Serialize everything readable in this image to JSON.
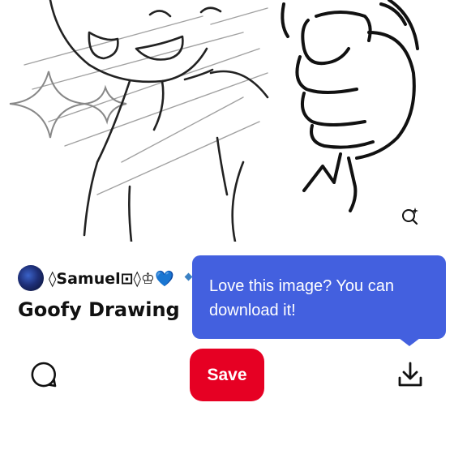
{
  "pin": {
    "author_name": "◊Samuel⊡◊♔💙",
    "title": "Goofy Drawing"
  },
  "tooltip": {
    "text": "Love this image? You can download it!"
  },
  "actions": {
    "save_label": "Save",
    "comment_icon": "comment-icon",
    "download_icon": "download-icon",
    "visual_search_icon": "visual-search-icon"
  },
  "colors": {
    "save_button": "#e60023",
    "tooltip_background": "#4360df",
    "text_primary": "#111111"
  }
}
